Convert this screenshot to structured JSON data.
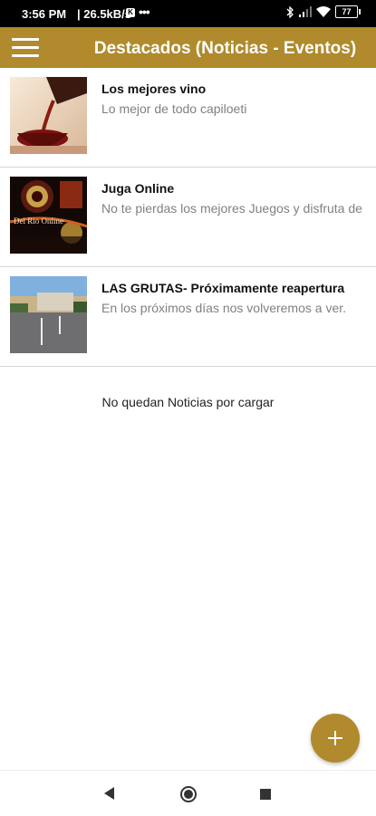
{
  "status_bar": {
    "time": "3:56 PM",
    "network_speed": "| 26.5kB/s",
    "notification_badge": "K",
    "more_dots": "•••",
    "battery": "77"
  },
  "app_bar": {
    "title": "Destacados (Noticias - Eventos)",
    "menu_icon": "hamburger-menu-icon",
    "color": "#b08a2c"
  },
  "news": [
    {
      "title": "Los mejores vino",
      "description": "Lo mejor de todo capiloeti",
      "image": "wine-pour-image"
    },
    {
      "title": "Juga Online",
      "description": "No te pierdas los mejores Juegos y disfruta de",
      "image": "casino-online-image",
      "image_text": "Del Rio Online"
    },
    {
      "title": "LAS GRUTAS- Próximamente reapertura",
      "description": "En los próximos días nos volveremos a ver.",
      "image": "beach-town-street-image"
    }
  ],
  "footer_message": "No quedan Noticias por cargar",
  "fab": {
    "icon": "plus-icon"
  },
  "nav_bar": {
    "back_icon": "back-triangle-icon",
    "home_icon": "home-circle-icon",
    "recents_icon": "recents-square-icon"
  }
}
